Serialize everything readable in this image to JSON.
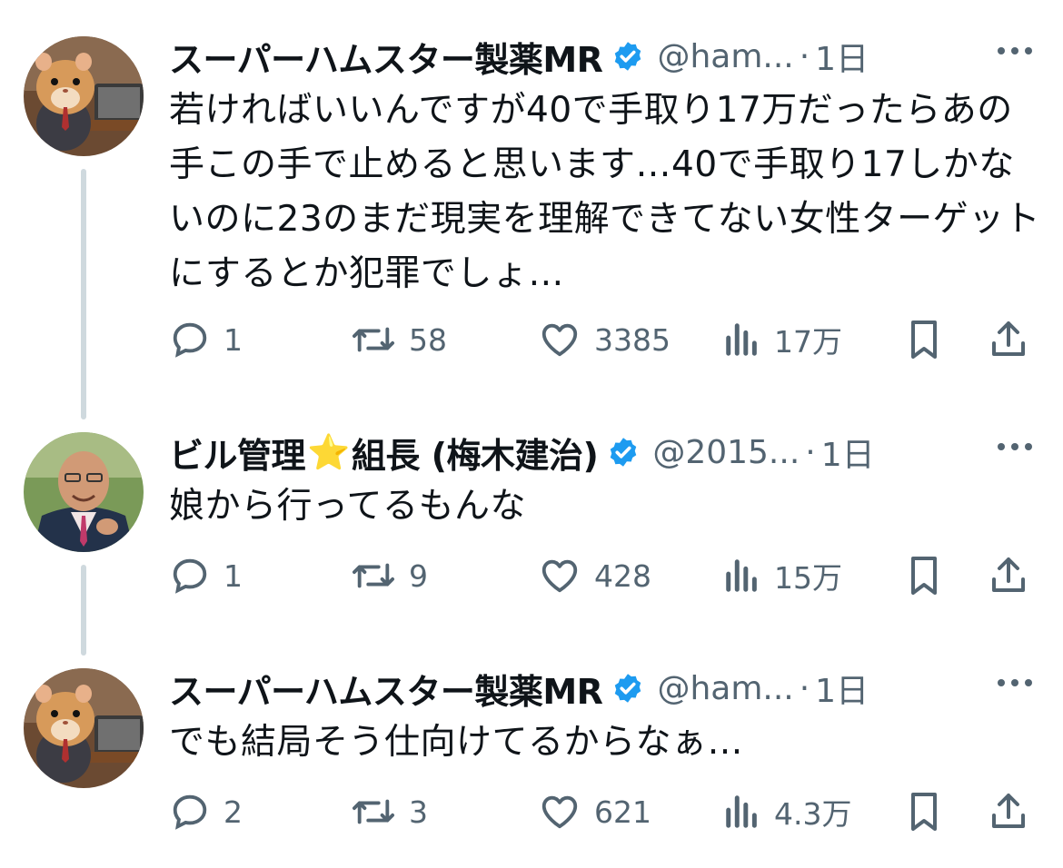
{
  "tweets": [
    {
      "name": "スーパーハムスター製薬MR",
      "handle": "@ham...",
      "time": "1日",
      "text": "若ければいいんですが40で手取り17万だったらあの手この手で止めると思います…40で手取り17しかないのに23のまだ現実を理解できてない女性ターゲットにするとか犯罪でしょ…",
      "replies": "1",
      "retweets": "58",
      "likes": "3385",
      "views": "17万"
    },
    {
      "name_pre": "ビル管理",
      "name_emoji": "⭐",
      "name_post": "組長 (梅木建治)",
      "handle": "@2015...",
      "time": "1日",
      "text": "娘から行ってるもんな",
      "replies": "1",
      "retweets": "9",
      "likes": "428",
      "views": "15万"
    },
    {
      "name": "スーパーハムスター製薬MR",
      "handle": "@ham...",
      "time": "1日",
      "text": "でも結局そう仕向けてるからなぁ…",
      "replies": "2",
      "retweets": "3",
      "likes": "621",
      "views": "4.3万"
    }
  ],
  "separator": "·",
  "icons": [
    "verified-badge-icon",
    "more-icon",
    "reply-icon",
    "retweet-icon",
    "like-icon",
    "views-icon",
    "bookmark-icon",
    "share-icon"
  ],
  "colors": {
    "verified": "#1d9bf0",
    "secondary_text": "#536471",
    "thread_line": "#cfd9de"
  }
}
